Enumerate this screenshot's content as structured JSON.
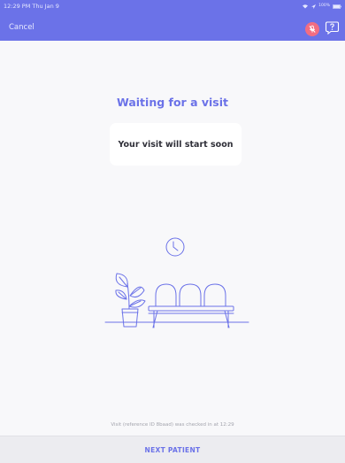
{
  "status_bar": {
    "time": "12:29 PM  Thu Jan 9",
    "battery": "100%"
  },
  "header": {
    "cancel_label": "Cancel",
    "mic_icon": "mic-off-icon",
    "help_icon": "help-bubble-icon"
  },
  "main": {
    "title": "Waiting for a visit",
    "card_text": "Your visit will start soon",
    "illustration_icons": [
      "clock-icon",
      "plant-icon",
      "waiting-chairs-icon"
    ]
  },
  "footer": {
    "checkin_note": "Visit (reference ID 8baad) was checked in at 12:29",
    "next_patient_label": "NEXT PATIENT"
  },
  "colors": {
    "brand": "#6b72e8",
    "mic_muted": "#f26d82",
    "background": "#f8f8fa",
    "footer_bg": "#ececf0"
  }
}
